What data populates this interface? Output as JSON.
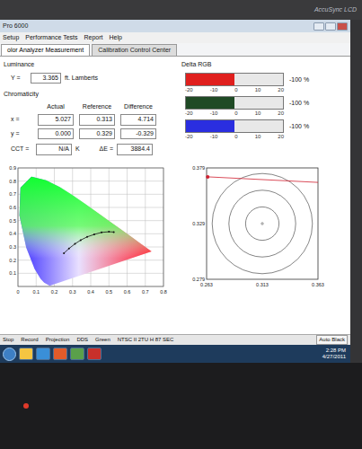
{
  "monitor": {
    "brand": "AccuSync LCD"
  },
  "window": {
    "title": "Pro 6000"
  },
  "menu": [
    "Setup",
    "Performance Tests",
    "Report",
    "Help"
  ],
  "tabs": [
    {
      "label": "olor Analyzer Measurement",
      "selected": true
    },
    {
      "label": "Calibration Control Center",
      "selected": false
    }
  ],
  "luminance": {
    "title": "Luminance",
    "label": "Y =",
    "value": "3.365",
    "unit": "ft. Lamberts"
  },
  "chromaticity": {
    "title": "Chromaticity",
    "columns": [
      "Actual",
      "Reference",
      "Difference"
    ],
    "rows": [
      {
        "label": "x =",
        "values": [
          "5.027",
          "0.313",
          "4.714"
        ]
      },
      {
        "label": "y =",
        "values": [
          "0.000",
          "0.329",
          "-0.329"
        ]
      }
    ],
    "cct": {
      "label": "CCT =",
      "value": "N/A",
      "unit": "K"
    },
    "delta_e": {
      "label": "ΔE =",
      "value": "3884.4"
    }
  },
  "delta_rgb": {
    "title": "Delta RGB",
    "ticks": [
      "-20",
      "-10",
      "0",
      "10",
      "20"
    ],
    "bars": [
      {
        "name": "red",
        "color": "#e0201e",
        "level": 0.5,
        "reading": "-100 %"
      },
      {
        "name": "green",
        "color": "#1f4a25",
        "level": 0.5,
        "reading": "-100 %"
      },
      {
        "name": "blue",
        "color": "#2a2ee0",
        "level": 0.5,
        "reading": "-100 %"
      }
    ]
  },
  "cie_chart": {
    "x_ticks": [
      "0",
      "0.1",
      "0.2",
      "0.3",
      "0.4",
      "0.5",
      "0.6",
      "0.7",
      "0.8"
    ],
    "y_ticks": [
      "0.1",
      "0.2",
      "0.3",
      "0.4",
      "0.5",
      "0.6",
      "0.7",
      "0.8",
      "0.9"
    ],
    "spectral_locus": [
      [
        0.1741,
        0.005
      ],
      [
        0.144,
        0.0297
      ],
      [
        0.1241,
        0.0578
      ],
      [
        0.0913,
        0.1327
      ],
      [
        0.0454,
        0.295
      ],
      [
        0.0082,
        0.5384
      ],
      [
        0.0139,
        0.7502
      ],
      [
        0.0743,
        0.8338
      ],
      [
        0.1547,
        0.8059
      ],
      [
        0.2296,
        0.7543
      ],
      [
        0.3016,
        0.6923
      ],
      [
        0.3731,
        0.6245
      ],
      [
        0.4441,
        0.5547
      ],
      [
        0.5125,
        0.4866
      ],
      [
        0.5752,
        0.4242
      ],
      [
        0.627,
        0.3725
      ],
      [
        0.6658,
        0.334
      ],
      [
        0.7347,
        0.2653
      ]
    ],
    "locus_points": [
      [
        0.2525,
        0.2518
      ],
      [
        0.2806,
        0.2883
      ],
      [
        0.3135,
        0.3236
      ],
      [
        0.3447,
        0.3516
      ],
      [
        0.3805,
        0.3768
      ],
      [
        0.4193,
        0.3951
      ],
      [
        0.4596,
        0.4105
      ],
      [
        0.5,
        0.4152
      ],
      [
        0.5267,
        0.4133
      ]
    ]
  },
  "target_chart": {
    "y_ticks": [
      "0.379",
      "0.329",
      "0.279"
    ],
    "x_ticks": [
      "0.263",
      "0.313",
      "0.363"
    ],
    "rings": [
      0.015,
      0.03,
      0.045
    ],
    "center": [
      0.313,
      0.329
    ],
    "marker": [
      0.264,
      0.371
    ],
    "line_end": [
      0.363,
      0.366
    ]
  },
  "status_bar": [
    "Stop",
    "Record",
    "Projection",
    "DDS",
    "Green",
    "NTSC II 2TU H 87 SEC",
    "Auto Black"
  ],
  "taskbar": {
    "time": "2:28 PM",
    "date": "4/27/2011"
  }
}
